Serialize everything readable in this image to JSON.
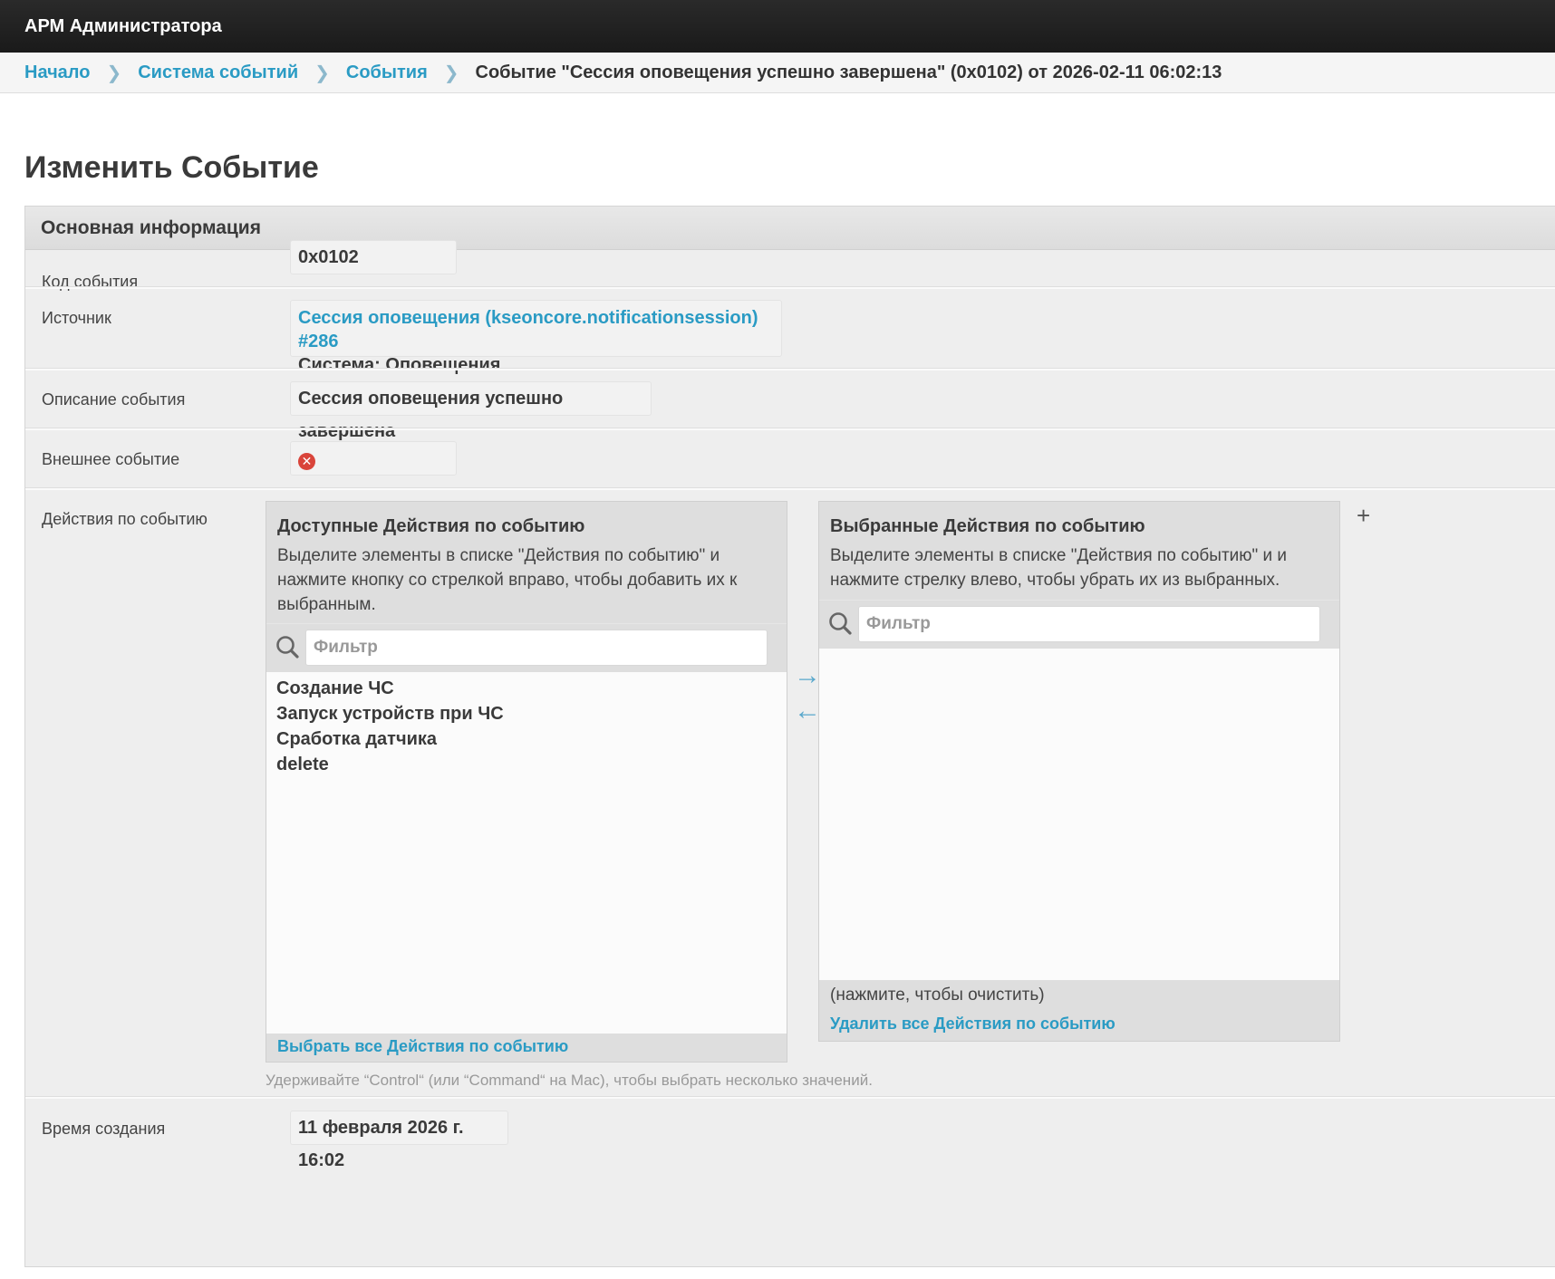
{
  "app": {
    "title": "АРМ Администратора"
  },
  "breadcrumb": {
    "items": [
      "Начало",
      "Система событий",
      "События"
    ],
    "current": "Событие \"Сессия оповещения успешно завершена\" (0x0102) от 2026-02-11 06:02:13"
  },
  "page": {
    "title": "Изменить Событие"
  },
  "section": {
    "title": "Основная информация"
  },
  "fields": {
    "code": {
      "label": "Код события",
      "value": "0x0102"
    },
    "source": {
      "label": "Источник",
      "link": "Сессия оповещения (kseoncore.notificationsession) #286",
      "system": "Система: Оповещения"
    },
    "description": {
      "label": "Описание события",
      "value": "Сессия оповещения успешно завершена"
    },
    "external": {
      "label": "Внешнее событие",
      "value_icon": "red-x-icon",
      "value": false
    },
    "actions": {
      "label": "Действия по событию"
    },
    "created": {
      "label": "Время создания",
      "value": "11 февраля 2026 г. 16:02"
    }
  },
  "available": {
    "title": "Доступные Действия по событию",
    "help": "Выделите элементы в списке \"Действия по событию\" и нажмите кнопку со стрелкой вправо, чтобы добавить их к выбранным.",
    "filter_placeholder": "Фильтр",
    "items": [
      "Создание ЧС",
      "Запуск устройств при ЧС",
      "Сработка датчика",
      "delete"
    ],
    "choose_all": "Выбрать все Действия по событию"
  },
  "chosen": {
    "title": "Выбранные Действия по событию",
    "help": "Выделите элементы в списке \"Действия по событию\" и и нажмите стрелку влево, чтобы убрать их из выбранных.",
    "filter_placeholder": "Фильтр",
    "items": [],
    "clear_hint": "(нажмите, чтобы очистить)",
    "remove_all": "Удалить все Действия по событию"
  },
  "help_text": "Удерживайте “Control“ (или “Command“ на Mac), чтобы выбрать несколько значений.",
  "icons": {
    "add": "plus-icon",
    "move_right": "arrow-right-icon",
    "move_left": "arrow-left-icon",
    "search": "search-icon"
  },
  "colors": {
    "accent": "#2a9bc4",
    "topbar": "#222222",
    "error": "#d9443a"
  }
}
